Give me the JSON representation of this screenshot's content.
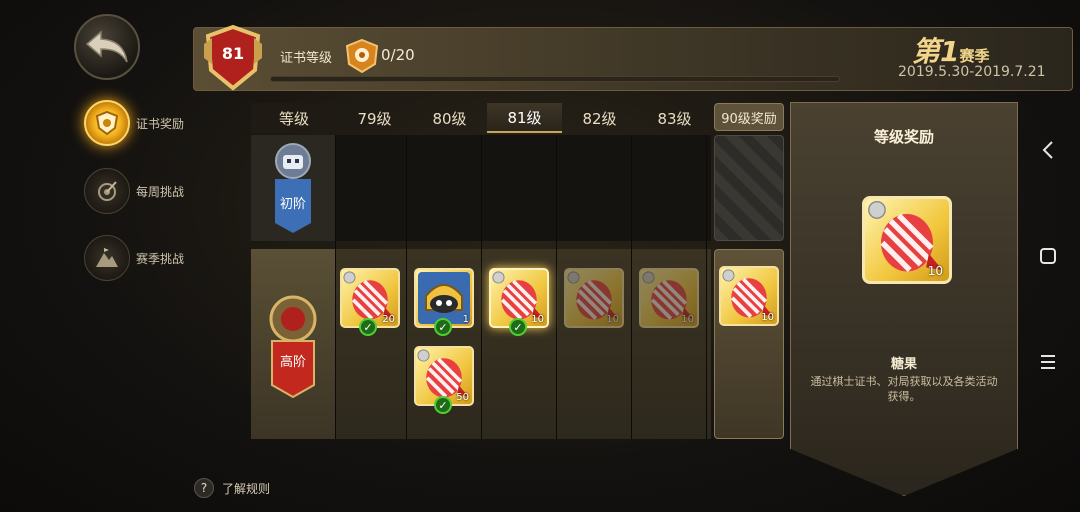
{
  "sidebar": {
    "items": [
      {
        "label": "证书奖励",
        "icon": "certificate-icon",
        "active": true
      },
      {
        "label": "每周挑战",
        "icon": "target-icon",
        "active": false
      },
      {
        "label": "赛季挑战",
        "icon": "mountain-icon",
        "active": false
      }
    ]
  },
  "header": {
    "level": "81",
    "cert_label": "证书等级",
    "progress": "0/20",
    "season_prefix": "第",
    "season_num": "1",
    "season_suffix": "赛季",
    "season_dates": "2019.5.30-2019.7.21"
  },
  "grid": {
    "header_first": "等级",
    "levels": [
      "79级",
      "80级",
      "81级",
      "82级",
      "83级"
    ],
    "active_level": "81级",
    "bonus_header": "90级奖励",
    "tier_basic": "初阶",
    "tier_advanced": "高阶",
    "rewards": [
      {
        "count": "20",
        "claimed": true
      },
      {
        "count": "1",
        "claimed": true,
        "type": "avatar"
      },
      {
        "count": "10",
        "claimed": true,
        "current": true
      },
      {
        "count": "10",
        "claimed": false
      },
      {
        "count": "10",
        "claimed": false
      }
    ],
    "extra_reward": {
      "count": "50",
      "claimed": true
    },
    "bonus_reward": {
      "count": "10"
    }
  },
  "detail": {
    "title": "等级奖励",
    "count": "10",
    "name": "糖果",
    "description": "通过棋士证书、对局获取以及各类活动获得。"
  },
  "footer": {
    "rules_icon": "?",
    "rules_label": "了解规则"
  },
  "colors": {
    "accent_gold": "#f3b21c",
    "candy_red": "#d42a2a",
    "check_green": "#4fcf32"
  }
}
